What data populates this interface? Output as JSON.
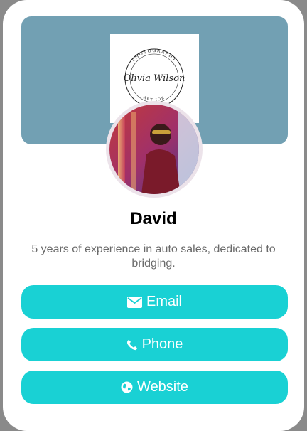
{
  "profile": {
    "logo_text": {
      "top": "PHOTOGRAPHY",
      "script": "Olivia Wilson",
      "bottom": "ART JOE"
    },
    "avatar_alt": "profile photo",
    "name": "David",
    "bio": "5 years of experience in auto sales, dedicated to bridging."
  },
  "buttons": {
    "email": {
      "label": "Email",
      "icon": "envelope-icon"
    },
    "phone": {
      "label": "Phone",
      "icon": "phone-icon"
    },
    "website": {
      "label": "Website",
      "icon": "globe-icon"
    }
  },
  "colors": {
    "banner": "#72a0b3",
    "button": "#19d1d4",
    "button_text": "#ffffff",
    "bio_text": "#6a6a6a"
  }
}
